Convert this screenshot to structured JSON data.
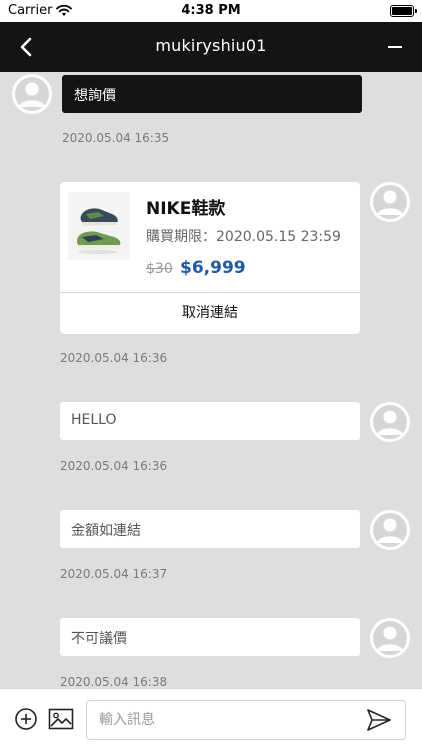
{
  "status_bar": {
    "carrier": "Carrier",
    "time": "4:38 PM",
    "icons": [
      "wifi-icon",
      "battery-icon"
    ]
  },
  "header": {
    "title": "mukiryshiu01",
    "icons": [
      "back-arrow-icon",
      "menu-dash-icon"
    ],
    "background": "#141414"
  },
  "messages": [
    {
      "side": "left",
      "text": "想詢價",
      "timestamp": "2020.05.04 16:35"
    },
    {
      "side": "right",
      "type": "product",
      "timestamp": "2020.05.04 16:36"
    },
    {
      "side": "right",
      "text": "HELLO",
      "timestamp": "2020.05.04 16:36"
    },
    {
      "side": "right",
      "text": "金額如連結",
      "timestamp": "2020.05.04 16:37"
    },
    {
      "side": "right",
      "text": "不可議價",
      "timestamp": "2020.05.04 16:38"
    }
  ],
  "product": {
    "name": "NIKE鞋款",
    "deadline": "購買期限：2020.05.15 23:59",
    "old_price": "$30",
    "price": "$6,999",
    "cancel_label": "取消連結",
    "price_color": "#1d5aa8"
  },
  "input_bar": {
    "placeholder": "輸入訊息",
    "icons": [
      "add-circle-icon",
      "image-icon",
      "send-icon"
    ]
  }
}
